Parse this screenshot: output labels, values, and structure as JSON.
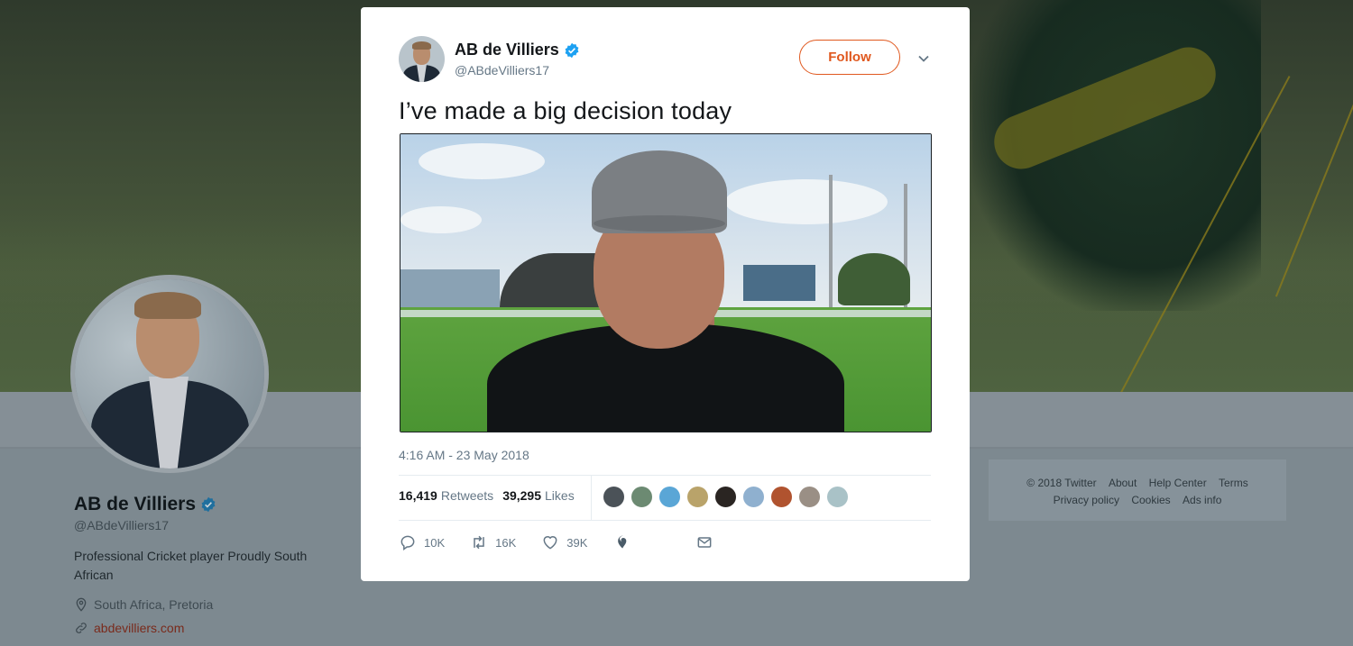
{
  "profile": {
    "name": "AB de Villiers",
    "handle": "@ABdeVilliers17",
    "bio": "Professional Cricket player Proudly South African",
    "location": "South Africa, Pretoria",
    "url": "abdevilliers.com"
  },
  "footer": {
    "links": [
      "© 2018 Twitter",
      "About",
      "Help Center",
      "Terms",
      "Privacy policy",
      "Cookies",
      "Ads info"
    ]
  },
  "tweet": {
    "author_name": "AB de Villiers",
    "author_handle": "@ABdeVilliers17",
    "follow_label": "Follow",
    "text": "I’ve made a big decision today",
    "timestamp": "4:16 AM - 23 May 2018",
    "retweets_count": "16,419",
    "retweets_label": "Retweets",
    "likes_count": "39,295",
    "likes_label": "Likes",
    "liker_colors": [
      "#4b5258",
      "#6c8a72",
      "#5aa6d6",
      "#b9a36a",
      "#2a2522",
      "#8fb0cf",
      "#b0532f",
      "#9a8f85",
      "#a9c2c7"
    ],
    "actions": {
      "reply_count": "10K",
      "retweet_count": "16K",
      "like_count": "39K"
    }
  },
  "colors": {
    "accent": "#e0581e",
    "verified": "#1da1f2",
    "secondary_text": "#657786"
  }
}
